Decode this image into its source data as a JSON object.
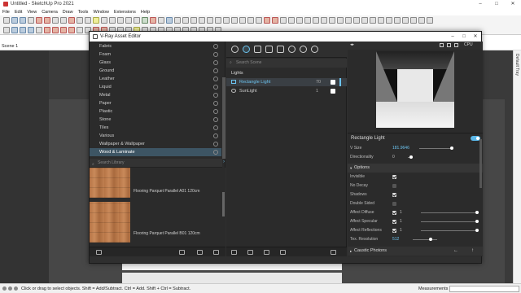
{
  "window": {
    "title": "Untitled - SketchUp Pro 2021",
    "minimize": "–",
    "maximize": "□",
    "close": "✕"
  },
  "menu": [
    "File",
    "Edit",
    "View",
    "Camera",
    "Draw",
    "Tools",
    "Window",
    "Extensions",
    "Help"
  ],
  "scene": {
    "tab": "Scene 1"
  },
  "default_tray": "Default Tray",
  "status": {
    "message": "Click or drag to select objects. Shift = Add/Subtract. Ctrl = Add. Shift + Ctrl = Subtract.",
    "measurements_label": "Measurements"
  },
  "vray": {
    "title": "V-Ray Asset Editor",
    "categories": [
      {
        "label": "Fabric",
        "selected": false
      },
      {
        "label": "Foam",
        "selected": false
      },
      {
        "label": "Glass",
        "selected": false
      },
      {
        "label": "Ground",
        "selected": false
      },
      {
        "label": "Leather",
        "selected": false
      },
      {
        "label": "Liquid",
        "selected": false
      },
      {
        "label": "Metal",
        "selected": false
      },
      {
        "label": "Paper",
        "selected": false
      },
      {
        "label": "Plastic",
        "selected": false
      },
      {
        "label": "Stone",
        "selected": false
      },
      {
        "label": "Tiles",
        "selected": false
      },
      {
        "label": "Various",
        "selected": false
      },
      {
        "label": "Wallpaper & Wallpaper",
        "selected": false
      },
      {
        "label": "Wood & Laminate",
        "selected": true
      }
    ],
    "library_search_placeholder": "Search Library",
    "library_items": [
      {
        "label": "Flooring Parquet Parallel A01 120cm"
      },
      {
        "label": "Flooring Parquet Parallel B01 120cm"
      }
    ],
    "scene_search_placeholder": "Search Scene",
    "section_title": "Lights",
    "lights": [
      {
        "name": "Rectangle Light",
        "value": "70",
        "selected": true
      },
      {
        "name": "SunLight",
        "value": "1",
        "selected": false
      }
    ],
    "render_label": "CPU",
    "light_settings": {
      "title": "Rectangle Light",
      "enabled": true,
      "v_size": {
        "label": "V Size",
        "value": "181.9646"
      },
      "directionality": {
        "label": "Directionality",
        "value": "0"
      },
      "options_title": "Options",
      "options": [
        {
          "label": "Invisible",
          "checked": true
        },
        {
          "label": "No Decay",
          "checked": false
        },
        {
          "label": "Shadows",
          "checked": true
        },
        {
          "label": "Double Sided",
          "checked": false
        },
        {
          "label": "Affect Diffuse",
          "checked": true,
          "value": "1"
        },
        {
          "label": "Affect Specular",
          "checked": true,
          "value": "1"
        },
        {
          "label": "Affect Reflections",
          "checked": true,
          "value": "1"
        }
      ],
      "tex_resolution": {
        "label": "Tex. Resolution",
        "value": "512"
      },
      "caustic_title": "Caustic Photons"
    }
  }
}
